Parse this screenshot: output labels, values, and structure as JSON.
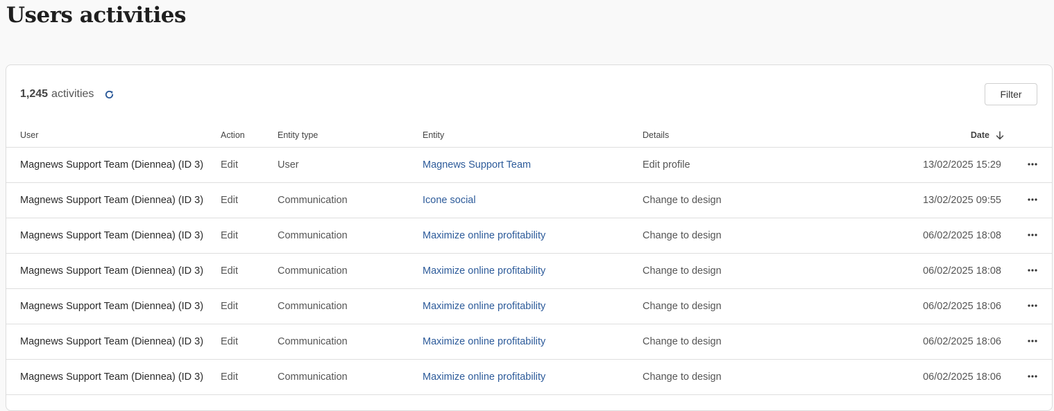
{
  "page": {
    "title": "Users activities"
  },
  "summary": {
    "count": "1,245",
    "label": "activities"
  },
  "toolbar": {
    "filter_label": "Filter"
  },
  "table": {
    "columns": {
      "user": "User",
      "action": "Action",
      "entity_type": "Entity type",
      "entity": "Entity",
      "details": "Details",
      "date": "Date"
    },
    "sort": {
      "column": "date",
      "direction": "descending",
      "icon": "arrow-down-icon"
    },
    "rows": [
      {
        "user": "Magnews Support Team (Diennea) (ID 3)",
        "action": "Edit",
        "entity_type": "User",
        "entity": "Magnews Support Team",
        "details": "Edit profile",
        "date": "13/02/2025 15:29"
      },
      {
        "user": "Magnews Support Team (Diennea) (ID 3)",
        "action": "Edit",
        "entity_type": "Communication",
        "entity": "Icone social",
        "details": "Change to design",
        "date": "13/02/2025 09:55"
      },
      {
        "user": "Magnews Support Team (Diennea) (ID 3)",
        "action": "Edit",
        "entity_type": "Communication",
        "entity": "Maximize online profitability",
        "details": "Change to design",
        "date": "06/02/2025 18:08"
      },
      {
        "user": "Magnews Support Team (Diennea) (ID 3)",
        "action": "Edit",
        "entity_type": "Communication",
        "entity": "Maximize online profitability",
        "details": "Change to design",
        "date": "06/02/2025 18:08"
      },
      {
        "user": "Magnews Support Team (Diennea) (ID 3)",
        "action": "Edit",
        "entity_type": "Communication",
        "entity": "Maximize online profitability",
        "details": "Change to design",
        "date": "06/02/2025 18:06"
      },
      {
        "user": "Magnews Support Team (Diennea) (ID 3)",
        "action": "Edit",
        "entity_type": "Communication",
        "entity": "Maximize online profitability",
        "details": "Change to design",
        "date": "06/02/2025 18:06"
      },
      {
        "user": "Magnews Support Team (Diennea) (ID 3)",
        "action": "Edit",
        "entity_type": "Communication",
        "entity": "Maximize online profitability",
        "details": "Change to design",
        "date": "06/02/2025 18:06"
      }
    ]
  },
  "colors": {
    "link": "#2d5b9a",
    "accent": "#2d5b9a",
    "border": "#dedede"
  }
}
